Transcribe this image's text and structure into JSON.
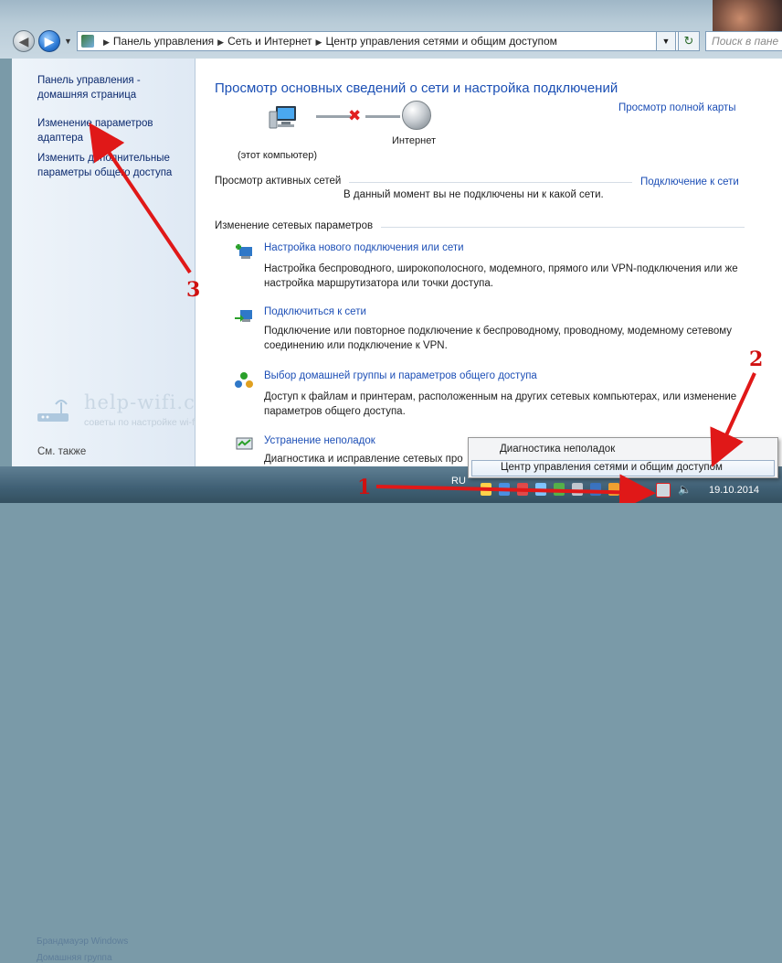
{
  "address": {
    "crumbs": [
      "Панель управления",
      "Сеть и Интернет",
      "Центр управления сетями и общим доступом"
    ],
    "search_placeholder": "Поиск в пане"
  },
  "sidebar": {
    "items": [
      "Панель управления - домашняя страница",
      "Изменение параметров адаптера",
      "Изменить дополнительные параметры общего доступа"
    ],
    "see_also": "См. также",
    "blurred": [
      "Брандмауэр Windows",
      "Домашняя группа"
    ]
  },
  "watermark": {
    "site": "help-wifi.com",
    "tagline": "советы по настройке wi-fi, роутеров, Smart TV"
  },
  "main": {
    "title": "Просмотр основных сведений о сети и настройка подключений",
    "map_link": "Просмотр полной карты",
    "pc_label": "(этот компьютер)",
    "internet_label": "Интернет",
    "active_networks": "Просмотр активных сетей",
    "connect_link": "Подключение к сети",
    "no_network": "В данный момент вы не подключены ни к какой сети.",
    "change_settings": "Изменение сетевых параметров",
    "tasks": [
      {
        "link": "Настройка нового подключения или сети",
        "desc": "Настройка беспроводного, широкополосного, модемного, прямого или VPN-подключения или же настройка маршрутизатора или точки доступа."
      },
      {
        "link": "Подключиться к сети",
        "desc": "Подключение или повторное подключение к беспроводному, проводному, модемному сетевому соединению или подключение к VPN."
      },
      {
        "link": "Выбор домашней группы и параметров общего доступа",
        "desc": "Доступ к файлам и принтерам, расположенным на других сетевых компьютерах, или изменение параметров общего доступа."
      },
      {
        "link": "Устранение неполадок",
        "desc": "Диагностика и исправление сетевых про"
      }
    ]
  },
  "context_menu": {
    "items": [
      "Диагностика неполадок",
      "Центр управления сетями и общим доступом"
    ]
  },
  "taskbar": {
    "tray_text": "RU",
    "clock": "19.10.2014"
  },
  "annotations": [
    "1",
    "2",
    "3"
  ],
  "colors": {
    "link": "#1d4fb6",
    "title": "#1b4fb4",
    "arrow": "#e01818"
  }
}
